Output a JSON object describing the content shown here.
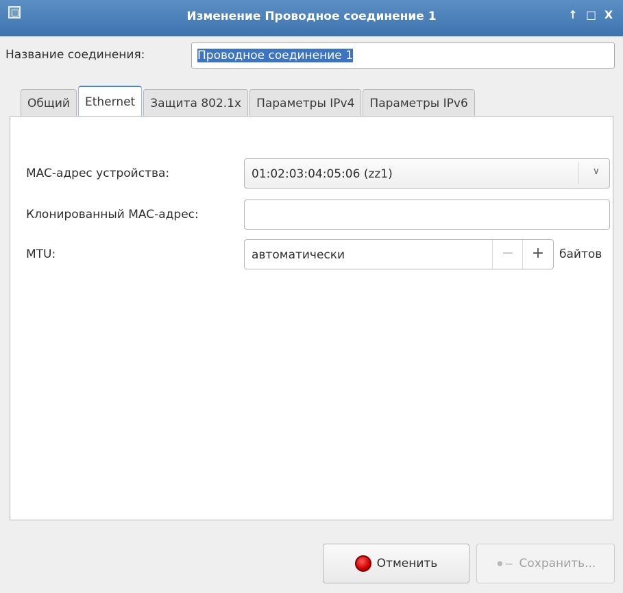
{
  "window": {
    "title": "Изменение Проводное соединение 1",
    "controls": {
      "minimize": "↑",
      "maximize": "□",
      "close": "X"
    }
  },
  "connection_name": {
    "label": "Название соединения:",
    "value": "Проводное соединение 1"
  },
  "tabs": [
    {
      "label": "Общий",
      "active": false
    },
    {
      "label": "Ethernet",
      "active": true
    },
    {
      "label": "Защита 802.1x",
      "active": false
    },
    {
      "label": "Параметры IPv4",
      "active": false
    },
    {
      "label": "Параметры IPv6",
      "active": false
    }
  ],
  "ethernet": {
    "device_mac_label": "MAC-адрес устройства:",
    "device_mac_value": "01:02:03:04:05:06 (zz1)",
    "cloned_mac_label": "Клонированный MAC-адрес:",
    "cloned_mac_value": "",
    "mtu_label": "MTU:",
    "mtu_value": "автоматически",
    "mtu_units": "байтов"
  },
  "buttons": {
    "cancel": "Отменить",
    "save": "Сохранить..."
  },
  "icons": {
    "app": "network-connection-icon",
    "cancel": "stop-icon",
    "save": "key-icon",
    "dropdown": "chevron-down-icon"
  }
}
